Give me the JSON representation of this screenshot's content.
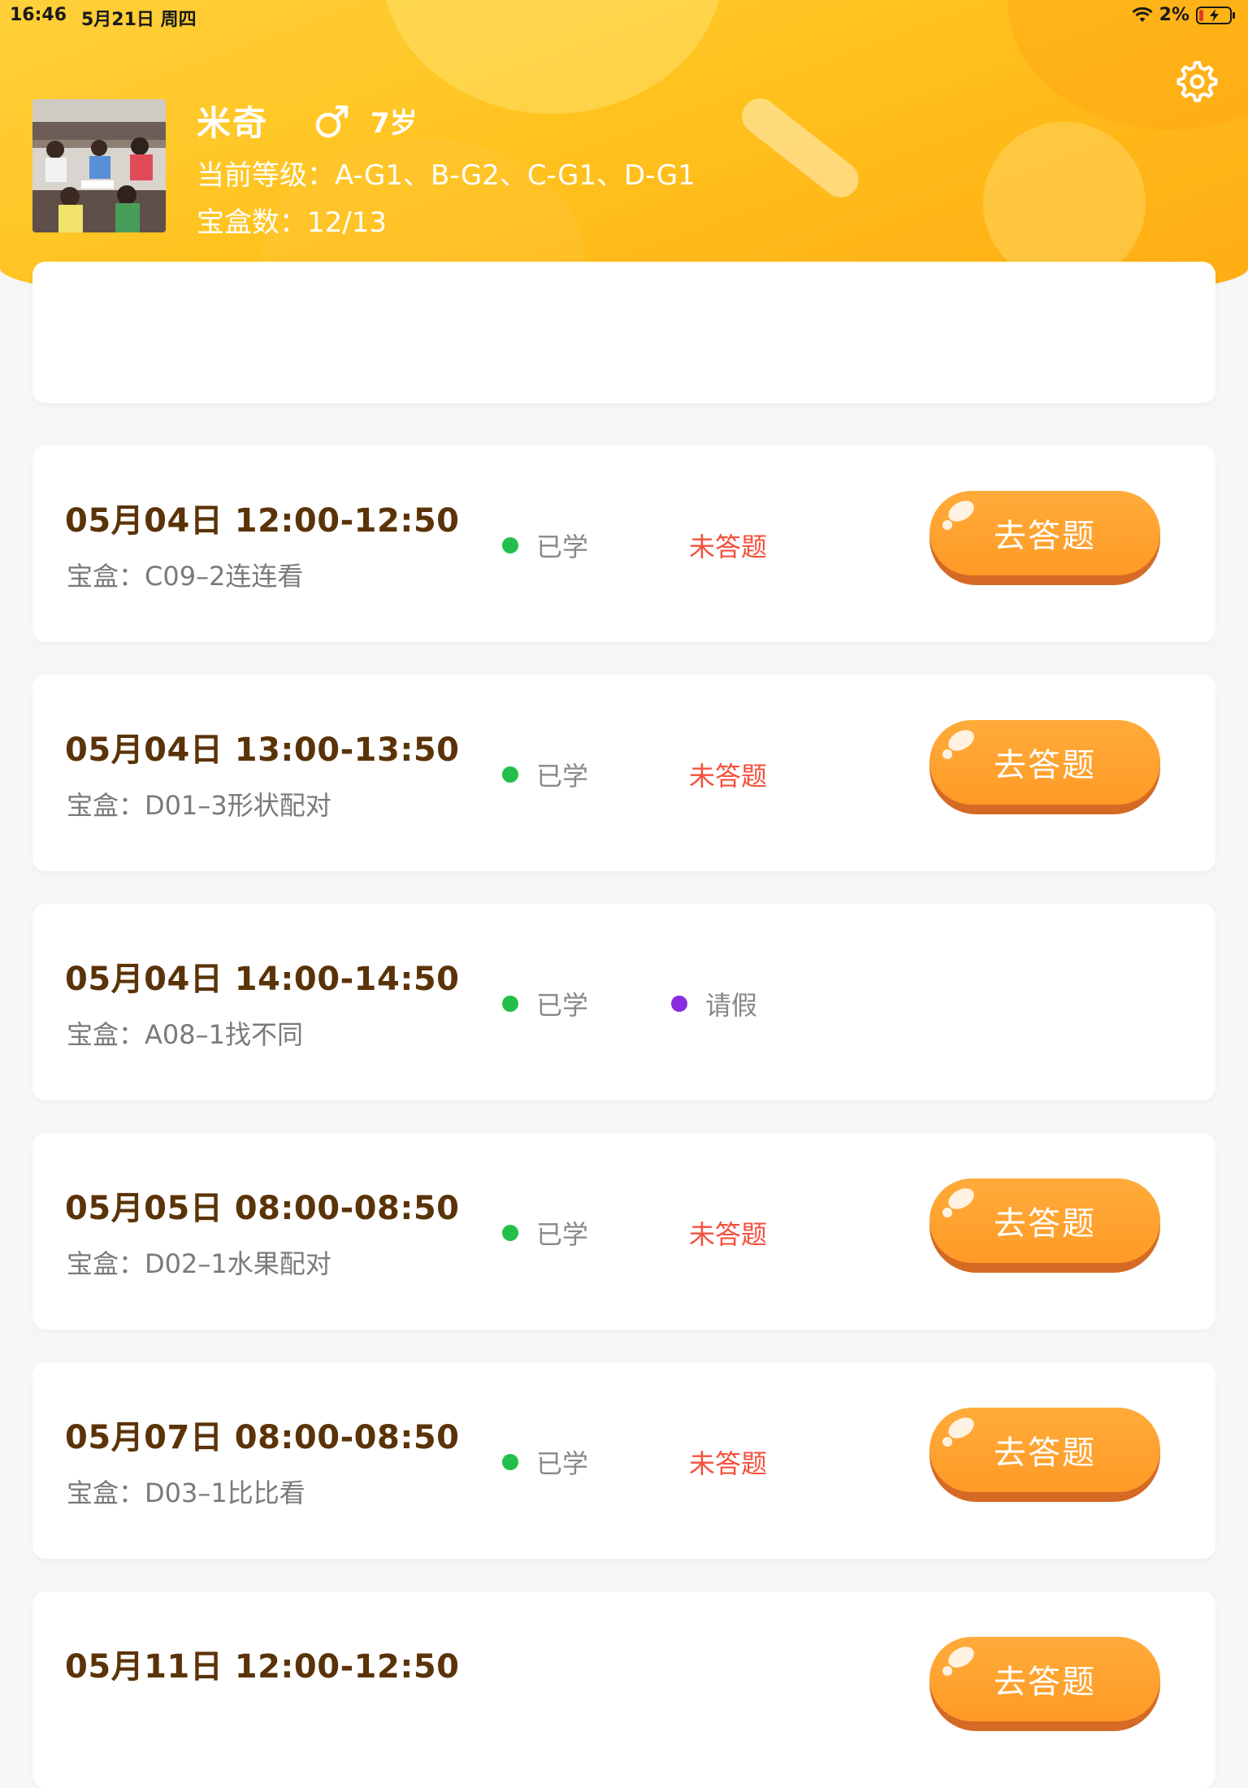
{
  "status_bar": {
    "time": "16:46",
    "date": "5月21日 周四",
    "battery": "2%"
  },
  "profile": {
    "name": "米奇",
    "age": "7岁",
    "level_label": "当前等级：",
    "level_value": "A-G1、B-G2、C-G1、D-G1",
    "box_label": "宝盒数：",
    "box_value": "12/13"
  },
  "lessons": [
    {
      "time": "05月04日 12:00-12:50",
      "box": "宝盒：C09–2连连看",
      "learned": "已学",
      "status": "未答题",
      "action": "去答题"
    },
    {
      "time": "05月04日 13:00-13:50",
      "box": "宝盒：D01–3形状配对",
      "learned": "已学",
      "status": "未答题",
      "action": "去答题"
    },
    {
      "time": "05月04日 14:00-14:50",
      "box": "宝盒：A08–1找不同",
      "learned": "已学",
      "status": "请假"
    },
    {
      "time": "05月05日 08:00-08:50",
      "box": "宝盒：D02–1水果配对",
      "learned": "已学",
      "status": "未答题",
      "action": "去答题"
    },
    {
      "time": "05月07日 08:00-08:50",
      "box": "宝盒：D03–1比比看",
      "learned": "已学",
      "status": "未答题",
      "action": "去答题"
    },
    {
      "time": "05月11日 12:00-12:50",
      "box": "",
      "learned": "",
      "status": "",
      "action": "去答题"
    }
  ],
  "colors": {
    "header_yellow": "#ffc21e",
    "title_brown": "#5b3308",
    "learned_green": "#22c04a",
    "unanswered_red": "#f4503c",
    "leave_purple": "#8a2be2",
    "button_orange": "#ff9a26"
  },
  "icons": {
    "settings": "gear-icon",
    "gender": "male-icon",
    "wifi": "wifi-icon",
    "battery": "battery-charging-icon"
  }
}
